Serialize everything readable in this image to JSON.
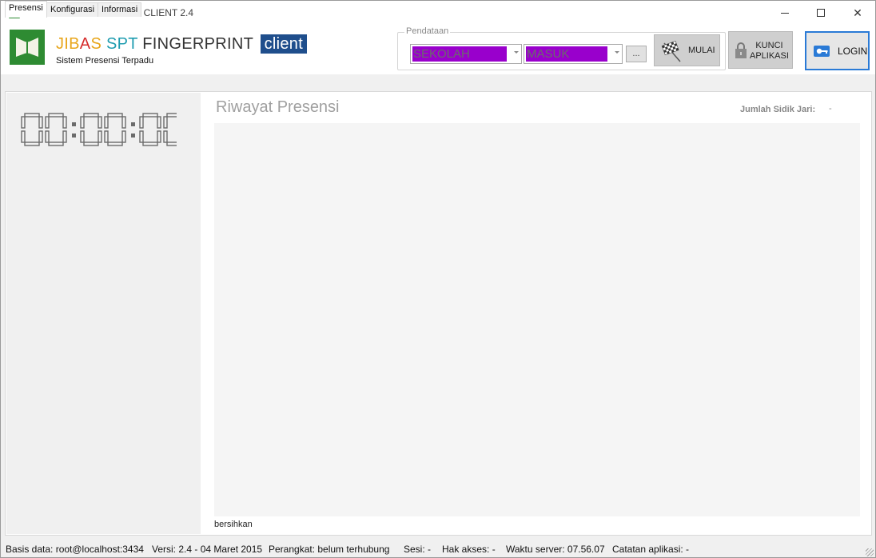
{
  "window": {
    "title": "JIBAS SPT FINGERPRINT CLIENT 2.4"
  },
  "header": {
    "brand_jib": "JIB",
    "brand_a": "A",
    "brand_s": "S",
    "brand_spt": "SPT",
    "brand_fingerprint": "FINGERPRINT",
    "brand_client": "client",
    "subtitle": "Sistem Presensi Terpadu",
    "pendataan": {
      "legend": "Pendataan",
      "lokasi_value": "SEKOLAH",
      "jenis_value": "MASUK",
      "browse_label": "..."
    },
    "mulai_label": "MULAI",
    "kunci_line1": "KUNCI",
    "kunci_line2": "APLIKASI",
    "login_label": "LOGIN",
    "colors": {
      "combo_highlight": "#9900cc",
      "brand_blue": "#1f4e8c",
      "login_border": "#2a7ad6"
    }
  },
  "tabs": [
    {
      "label": "Presensi",
      "active": true
    },
    {
      "label": "Konfigurasi",
      "active": false
    },
    {
      "label": "Informasi",
      "active": false
    }
  ],
  "main": {
    "clock": "00:00:00",
    "history_title": "Riwayat Presensi",
    "jumlah_label": "Jumlah Sidik Jari:",
    "jumlah_value": "-",
    "bersihkan_label": "bersihkan"
  },
  "statusbar": {
    "basis_data": "Basis data: root@localhost:3434",
    "versi": "Versi: 2.4 - 04 Maret 2015",
    "perangkat": "Perangkat: belum terhubung",
    "sesi": "Sesi: -",
    "hak_akses": "Hak akses: -",
    "waktu_server": "Waktu server: 07.56.07",
    "catatan": "Catatan aplikasi: -"
  }
}
